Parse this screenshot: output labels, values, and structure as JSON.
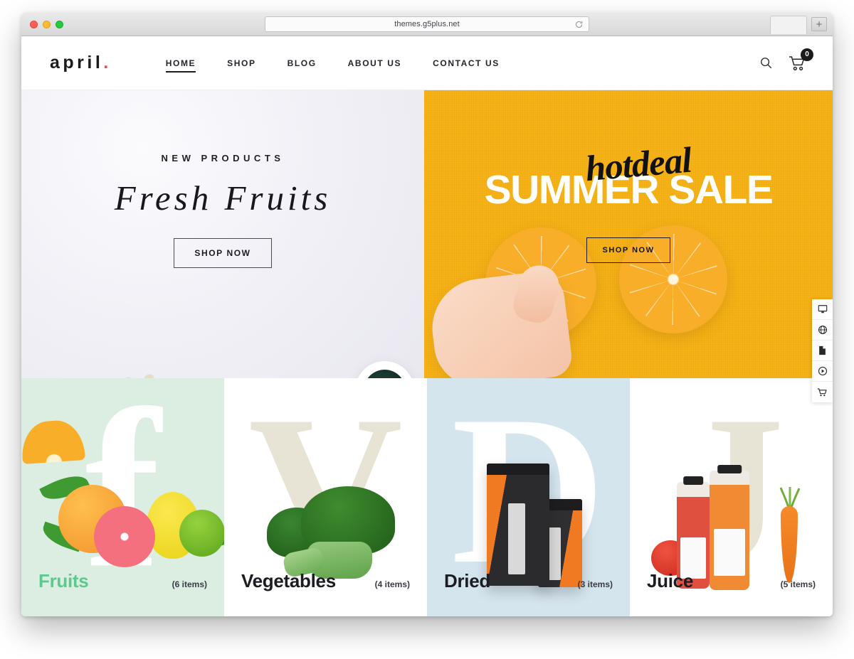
{
  "browser": {
    "url": "themes.g5plus.net",
    "reload_icon": "reload-icon",
    "newtab_label": "+",
    "traffic_lights": [
      "close",
      "minimize",
      "maximize"
    ]
  },
  "site": {
    "logo_text": "april",
    "logo_mark": ".",
    "nav": [
      {
        "label": "HOME",
        "active": true
      },
      {
        "label": "SHOP",
        "active": false
      },
      {
        "label": "BLOG",
        "active": false
      },
      {
        "label": "ABOUT US",
        "active": false
      },
      {
        "label": "CONTACT US",
        "active": false
      }
    ],
    "actions": {
      "search_icon": "search-icon",
      "cart_icon": "cart-icon",
      "cart_count": "0"
    }
  },
  "hero_left": {
    "kicker": "NEW PRODUCTS",
    "title": "Fresh Fruits",
    "button": "SHOP NOW",
    "background_color": "#edecf3"
  },
  "hero_right": {
    "script_text": "hotdeal",
    "headline": "SUMMER SALE",
    "button": "SHOP NOW",
    "background_color": "#f5b013"
  },
  "side_toolbar": [
    {
      "icon": "monitor-icon"
    },
    {
      "icon": "globe-icon"
    },
    {
      "icon": "document-icon"
    },
    {
      "icon": "play-circle-icon"
    },
    {
      "icon": "cart-icon"
    }
  ],
  "categories": [
    {
      "title": "Fruits",
      "count": "(6 items)",
      "watermark": "f",
      "bg": "#dceee2",
      "title_color": "#5ec98c"
    },
    {
      "title": "Vegetables",
      "count": "(4 items)",
      "watermark": "V",
      "bg": "#ffffff",
      "title_color": "#1c1c22"
    },
    {
      "title": "Dried",
      "count": "(3 items)",
      "watermark": "D",
      "bg": "#d5e5ee",
      "title_color": "#1c1c22"
    },
    {
      "title": "Juice",
      "count": "(5 items)",
      "watermark": "J",
      "bg": "#ffffff",
      "title_color": "#1c1c22"
    }
  ],
  "colors": {
    "accent_red": "#ee4c4c",
    "brand_yellow": "#f5b013",
    "fruits_green": "#5ec98c",
    "ink": "#1c1c22"
  }
}
